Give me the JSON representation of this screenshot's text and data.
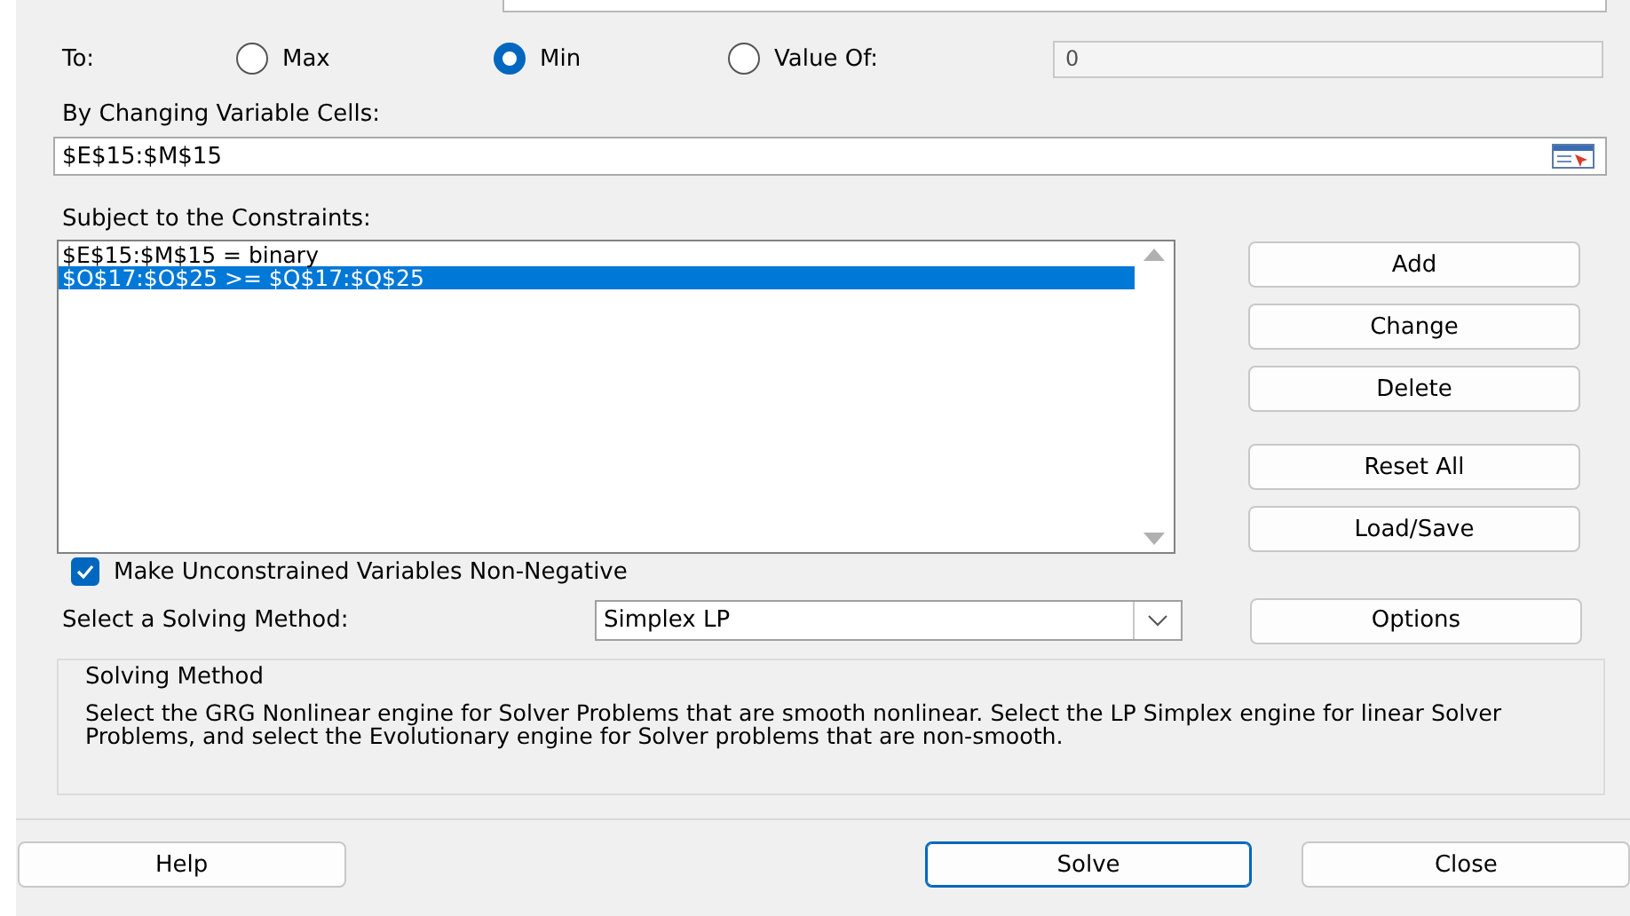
{
  "to": {
    "label": "To:",
    "options": [
      {
        "label": "Max",
        "selected": false
      },
      {
        "label": "Min",
        "selected": true
      },
      {
        "label": "Value Of:",
        "selected": false
      }
    ],
    "value_of": {
      "value": "0",
      "disabled": true
    }
  },
  "changing_cells": {
    "label": "By Changing Variable Cells:",
    "value": "$E$15:$M$15"
  },
  "constraints": {
    "label": "Subject to the Constraints:",
    "items": [
      {
        "text": "$E$15:$M$15 = binary",
        "selected": false
      },
      {
        "text": "$O$17:$O$25 >= $Q$17:$Q$25",
        "selected": true
      }
    ]
  },
  "constraint_buttons": [
    "Add",
    "Change",
    "Delete",
    "Reset All",
    "Load/Save"
  ],
  "non_negative": {
    "label": "Make Unconstrained Variables Non-Negative",
    "checked": true
  },
  "solving_method": {
    "label": "Select a Solving Method:",
    "value": "Simplex LP",
    "options_button": "Options"
  },
  "description": {
    "title": "Solving Method",
    "text": "Select the GRG Nonlinear engine for Solver Problems that are smooth nonlinear. Select the LP Simplex engine for linear Solver Problems, and select the Evolutionary engine for Solver problems that are non-smooth."
  },
  "footer_buttons": [
    {
      "label": "Help",
      "default": false
    },
    {
      "label": "Solve",
      "default": true
    },
    {
      "label": "Close",
      "default": false
    }
  ]
}
